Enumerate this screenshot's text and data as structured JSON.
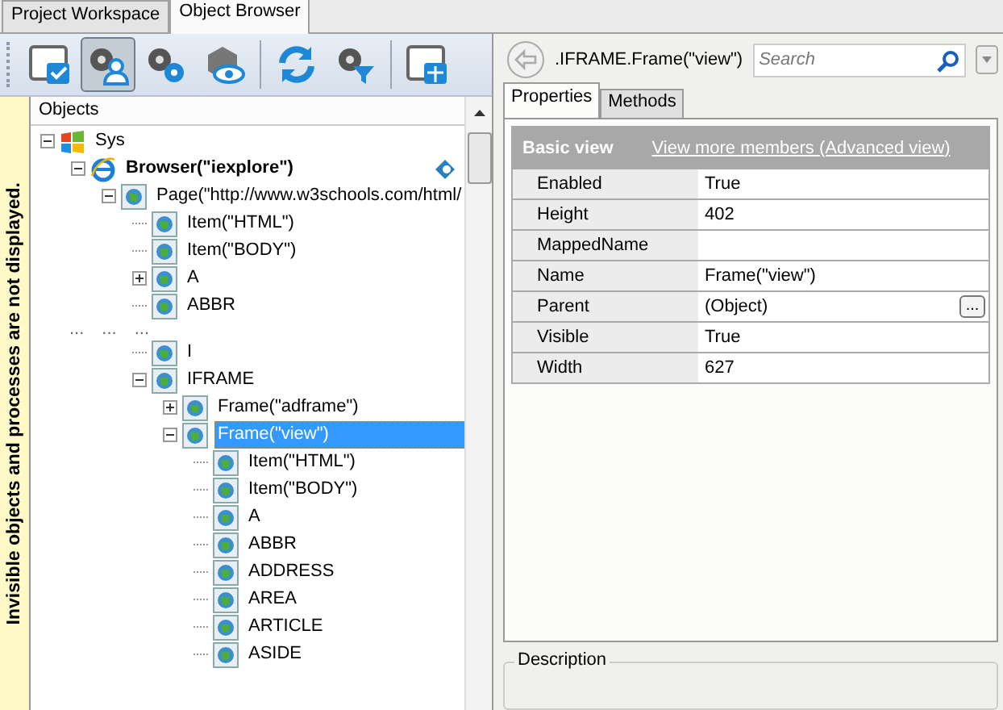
{
  "tabs": [
    {
      "label": "Project Workspace",
      "selected": false
    },
    {
      "label": "Object Browser",
      "selected": true
    }
  ],
  "toolbar_groups": [
    [
      {
        "pressed": false
      },
      {
        "pressed": true
      },
      {
        "pressed": false
      },
      {
        "pressed": false
      }
    ],
    [
      {
        "pressed": false
      },
      {
        "pressed": false
      }
    ],
    [
      {
        "pressed": false
      }
    ]
  ],
  "notice": "Invisible objects and processes are not displayed.",
  "tree": {
    "header": "Objects",
    "nodes": [
      {
        "kind": "windows",
        "label": "Sys",
        "bold": false,
        "selected": false,
        "expanded": true,
        "children": [
          {
            "kind": "browser",
            "label": "Browser(\"iexplore\")",
            "bold": true,
            "selected": false,
            "expanded": true,
            "marker": true,
            "children": [
              {
                "kind": "globe",
                "label": "Page(\"http://www.w3schools.com/html/",
                "bold": false,
                "selected": false,
                "expanded": true,
                "children": [
                  {
                    "kind": "globe",
                    "label": "Item(\"HTML\")",
                    "bold": false,
                    "selected": false
                  },
                  {
                    "kind": "globe",
                    "label": "Item(\"BODY\")",
                    "bold": false,
                    "selected": false
                  },
                  {
                    "kind": "globe",
                    "label": "A",
                    "bold": false,
                    "selected": false,
                    "expanded": false
                  },
                  {
                    "kind": "globe",
                    "label": "ABBR",
                    "bold": false,
                    "selected": false
                  },
                  {
                    "kind": "gap",
                    "dots": [
                      "...",
                      "...",
                      "..."
                    ]
                  },
                  {
                    "kind": "globe",
                    "label": "I",
                    "bold": false,
                    "selected": false
                  },
                  {
                    "kind": "globe",
                    "label": "IFRAME",
                    "bold": false,
                    "selected": false,
                    "expanded": true,
                    "children": [
                      {
                        "kind": "globe",
                        "label": "Frame(\"adframe\")",
                        "bold": false,
                        "selected": false,
                        "expanded": false
                      },
                      {
                        "kind": "globe",
                        "label": "Frame(\"view\")",
                        "bold": false,
                        "selected": true,
                        "expanded": true,
                        "children": [
                          {
                            "kind": "globe",
                            "label": "Item(\"HTML\")",
                            "bold": false,
                            "selected": false
                          },
                          {
                            "kind": "globe",
                            "label": "Item(\"BODY\")",
                            "bold": false,
                            "selected": false
                          },
                          {
                            "kind": "globe",
                            "label": "A",
                            "bold": false,
                            "selected": false
                          },
                          {
                            "kind": "globe",
                            "label": "ABBR",
                            "bold": false,
                            "selected": false
                          },
                          {
                            "kind": "globe",
                            "label": "ADDRESS",
                            "bold": false,
                            "selected": false
                          },
                          {
                            "kind": "globe",
                            "label": "AREA",
                            "bold": false,
                            "selected": false
                          },
                          {
                            "kind": "globe",
                            "label": "ARTICLE",
                            "bold": false,
                            "selected": false
                          },
                          {
                            "kind": "globe",
                            "label": "ASIDE",
                            "bold": false,
                            "selected": false
                          }
                        ]
                      }
                    ]
                  }
                ]
              }
            ]
          }
        ]
      }
    ]
  },
  "path": ".IFRAME.Frame(\"view\")",
  "search": {
    "placeholder": "Search"
  },
  "panel_tabs": [
    {
      "label": "Properties",
      "selected": true
    },
    {
      "label": "Methods",
      "selected": false
    }
  ],
  "grid": {
    "title": "Basic view",
    "link": "View more members (Advanced view)",
    "rows": [
      {
        "name": "Enabled",
        "value": "True"
      },
      {
        "name": "Height",
        "value": "402"
      },
      {
        "name": "MappedName"
      },
      {
        "name": "Name",
        "value": "Frame(\"view\")"
      },
      {
        "name": "Parent",
        "value": "(Object)",
        "button": "..."
      },
      {
        "name": "Visible",
        "value": "True"
      },
      {
        "name": "Width",
        "value": "627"
      }
    ]
  },
  "description": {
    "title": "Description"
  }
}
